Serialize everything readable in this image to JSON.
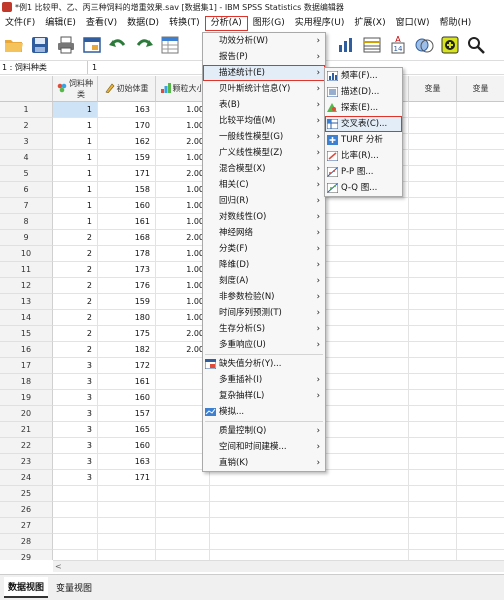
{
  "window": {
    "title": "*例1 比较甲、乙、丙三种饲料的增重效果.sav [数据集1] - IBM SPSS Statistics 数据编辑器"
  },
  "menubar": [
    "文件(F)",
    "编辑(E)",
    "查看(V)",
    "数据(D)",
    "转换(T)",
    "分析(A)",
    "图形(G)",
    "实用程序(U)",
    "扩展(X)",
    "窗口(W)",
    "帮助(H)"
  ],
  "toolbar": [
    "open-icon",
    "save-icon",
    "print-icon",
    "dialog-recall-icon",
    "undo-icon",
    "redo-icon",
    "goto-case-icon"
  ],
  "toolbar_right": [
    "chart-builder-icon",
    "split-file-icon",
    "value-labels-icon",
    "use-sets-icon",
    "add-on-icon",
    "search-icon"
  ],
  "cell_editor": {
    "ref": "1 : 饲料种类",
    "value": "1"
  },
  "columns": [
    {
      "label": "饲料种\n类",
      "icon": "nominal-icon"
    },
    {
      "label": "初始体重",
      "icon": "scale-icon"
    },
    {
      "label": "颗粒大小",
      "icon": "ordinal-icon"
    }
  ],
  "right_columns": [
    "变量",
    "变量"
  ],
  "rows": [
    [
      "1",
      "163",
      "1.00"
    ],
    [
      "1",
      "170",
      "1.00"
    ],
    [
      "1",
      "162",
      "2.00"
    ],
    [
      "1",
      "159",
      "1.00"
    ],
    [
      "1",
      "171",
      "2.00"
    ],
    [
      "1",
      "158",
      "1.00"
    ],
    [
      "1",
      "160",
      "1.00"
    ],
    [
      "1",
      "161",
      "1.00"
    ],
    [
      "2",
      "168",
      "2.00"
    ],
    [
      "2",
      "178",
      "1.00"
    ],
    [
      "2",
      "173",
      "1.00"
    ],
    [
      "2",
      "176",
      "1.00"
    ],
    [
      "2",
      "159",
      "1.00"
    ],
    [
      "2",
      "180",
      "1.00"
    ],
    [
      "2",
      "175",
      "2.00"
    ],
    [
      "2",
      "182",
      "2.00"
    ],
    [
      "3",
      "172",
      ""
    ],
    [
      "3",
      "161",
      ""
    ],
    [
      "3",
      "160",
      ""
    ],
    [
      "3",
      "157",
      ""
    ],
    [
      "3",
      "165",
      ""
    ],
    [
      "3",
      "160",
      ""
    ],
    [
      "3",
      "163",
      ""
    ],
    [
      "3",
      "171",
      ""
    ],
    [
      "",
      "",
      ""
    ],
    [
      "",
      "",
      ""
    ],
    [
      "",
      "",
      ""
    ],
    [
      "",
      "",
      ""
    ],
    [
      "",
      "",
      ""
    ],
    [
      "",
      "",
      ""
    ],
    [
      "",
      "",
      ""
    ],
    [
      "",
      "",
      ""
    ]
  ],
  "analyze_menu": [
    {
      "label": "功效分析(W)",
      "sub": true
    },
    {
      "label": "报告(P)",
      "sub": true
    },
    {
      "label": "描述统计(E)",
      "sub": true,
      "highlight": true
    },
    {
      "label": "贝叶斯统计信息(Y)",
      "sub": true
    },
    {
      "label": "表(B)",
      "sub": true
    },
    {
      "label": "比较平均值(M)",
      "sub": true
    },
    {
      "label": "一般线性模型(G)",
      "sub": true
    },
    {
      "label": "广义线性模型(Z)",
      "sub": true
    },
    {
      "label": "混合模型(X)",
      "sub": true
    },
    {
      "label": "相关(C)",
      "sub": true
    },
    {
      "label": "回归(R)",
      "sub": true
    },
    {
      "label": "对数线性(O)",
      "sub": true
    },
    {
      "label": "神经网络",
      "sub": true
    },
    {
      "label": "分类(F)",
      "sub": true
    },
    {
      "label": "降维(D)",
      "sub": true
    },
    {
      "label": "刻度(A)",
      "sub": true
    },
    {
      "label": "非参数检验(N)",
      "sub": true
    },
    {
      "label": "时间序列预测(T)",
      "sub": true
    },
    {
      "label": "生存分析(S)",
      "sub": true
    },
    {
      "label": "多重响应(U)",
      "sub": true
    },
    {
      "label": "缺失值分析(Y)...",
      "sub": false,
      "icon": "missing-values-icon"
    },
    {
      "label": "多重插补(I)",
      "sub": true
    },
    {
      "label": "复杂抽样(L)",
      "sub": true
    },
    {
      "label": "模拟...",
      "sub": false,
      "icon": "simulation-icon"
    },
    {
      "label": "质量控制(Q)",
      "sub": true
    },
    {
      "label": "空间和时间建模...",
      "sub": true
    },
    {
      "label": "直销(K)",
      "sub": true
    }
  ],
  "descriptive_menu": [
    {
      "label": "频率(F)...",
      "icon": "frequencies-icon"
    },
    {
      "label": "描述(D)...",
      "icon": "descriptives-icon"
    },
    {
      "label": "探索(E)...",
      "icon": "explore-icon"
    },
    {
      "label": "交叉表(C)...",
      "icon": "crosstabs-icon",
      "highlight": true
    },
    {
      "label": "TURF 分析",
      "icon": "turf-icon"
    },
    {
      "label": "比率(R)...",
      "icon": "ratio-icon"
    },
    {
      "label": "P-P 图...",
      "icon": "pp-plot-icon"
    },
    {
      "label": "Q-Q 图...",
      "icon": "qq-plot-icon"
    }
  ],
  "tabs": [
    "数据视图",
    "变量视图"
  ],
  "colors": {
    "highlight_border": "#e0342b",
    "selection": "#cfe3f7"
  }
}
